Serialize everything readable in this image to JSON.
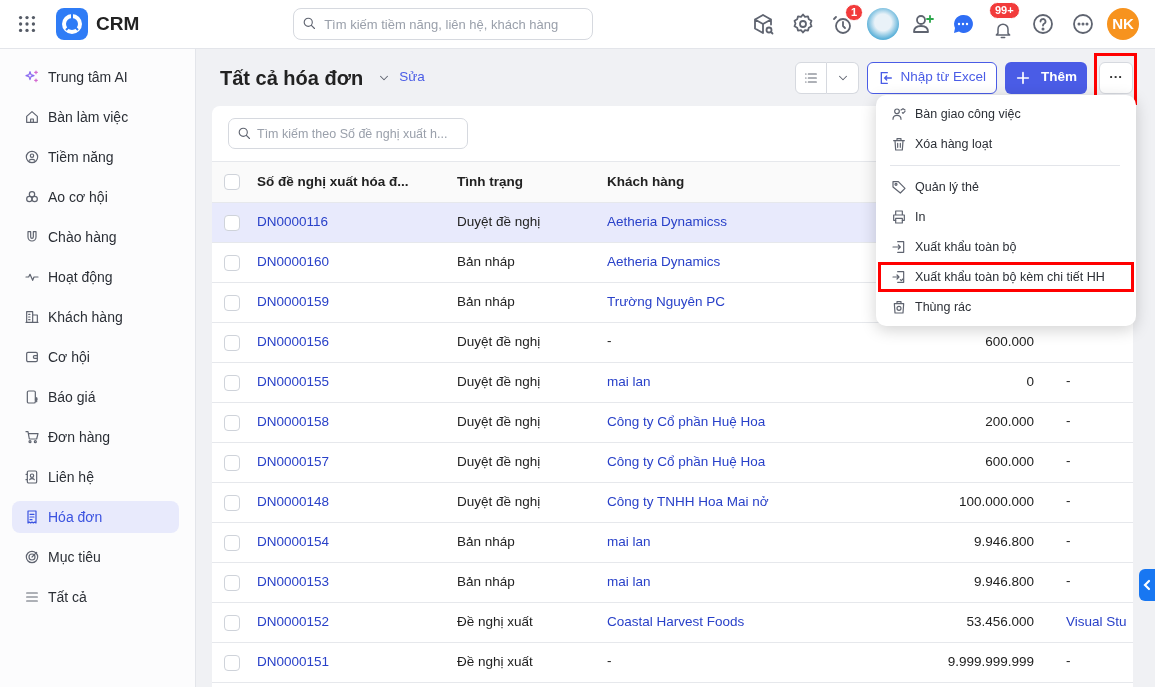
{
  "header": {
    "app_name": "CRM",
    "search": {
      "placeholder": "Tìm kiếm tiềm năng, liên hệ, khách hàng"
    },
    "timer_badge": "1",
    "notification_badge": "99+",
    "user_initials": "NK"
  },
  "sidebar": {
    "items": [
      {
        "label": "Trung tâm AI",
        "selected": false
      },
      {
        "label": "Bàn làm việc",
        "selected": false
      },
      {
        "label": "Tiềm năng",
        "selected": false
      },
      {
        "label": "Ao cơ hội",
        "selected": false
      },
      {
        "label": "Chào hàng",
        "selected": false
      },
      {
        "label": "Hoạt động",
        "selected": false
      },
      {
        "label": "Khách hàng",
        "selected": false
      },
      {
        "label": "Cơ hội",
        "selected": false
      },
      {
        "label": "Báo giá",
        "selected": false
      },
      {
        "label": "Đơn hàng",
        "selected": false
      },
      {
        "label": "Liên hệ",
        "selected": false
      },
      {
        "label": "Hóa đơn",
        "selected": true
      },
      {
        "label": "Mục tiêu",
        "selected": false
      },
      {
        "label": "Tất cả",
        "selected": false
      }
    ]
  },
  "page": {
    "title": "Tất cả hóa đơn",
    "edit_link": "Sửa",
    "import_button": "Nhập từ Excel",
    "add_button": "Thêm",
    "more_button": {
      "label": "···",
      "highlighted": true
    }
  },
  "menu": {
    "items": [
      {
        "label": "Bàn giao công việc",
        "highlighted": false
      },
      {
        "label": "Xóa hàng loạt",
        "highlighted": false
      },
      {
        "label": "Quản lý thẻ",
        "highlighted": false
      },
      {
        "label": "In",
        "highlighted": false
      },
      {
        "label": "Xuất khẩu toàn bộ",
        "highlighted": false
      },
      {
        "label": "Xuất khẩu toàn bộ kèm chi tiết HH",
        "highlighted": true
      },
      {
        "label": "Thùng rác",
        "highlighted": false
      }
    ]
  },
  "table": {
    "search": {
      "placeholder": "Tìm kiếm theo Số đề nghị xuất h..."
    },
    "select_all_checked": false,
    "columns": [
      "Số đề nghị xuất hóa đ...",
      "Tình trạng",
      "Khách hàng"
    ],
    "rows": [
      {
        "number": "DN0000116",
        "status": "Duyệt đề nghị",
        "customer": "Aetheria Dynamicss",
        "customer_link": true,
        "checked": false,
        "selected": true
      },
      {
        "number": "DN0000160",
        "status": "Bản nháp",
        "customer": "Aetheria Dynamics",
        "customer_link": true,
        "checked": false,
        "selected": false
      },
      {
        "number": "DN0000159",
        "status": "Bản nháp",
        "customer": "Trường Nguyên PC",
        "customer_link": true,
        "checked": false,
        "selected": false
      },
      {
        "number": "DN0000156",
        "status": "Duyệt đề nghị",
        "customer": "-",
        "customer_link": false,
        "amount": "600.000",
        "checked": false,
        "selected": false
      },
      {
        "number": "DN0000155",
        "status": "Duyệt đề nghị",
        "customer": "mai lan",
        "customer_link": true,
        "amount": "0",
        "column_5": "-",
        "checked": false,
        "selected": false
      },
      {
        "number": "DN0000158",
        "status": "Duyệt đề nghị",
        "customer": "Công ty Cổ phần Huệ Hoa",
        "customer_link": true,
        "amount": "200.000",
        "column_5": "-",
        "checked": false,
        "selected": false
      },
      {
        "number": "DN0000157",
        "status": "Duyệt đề nghị",
        "customer": "Công ty Cổ phần Huệ Hoa",
        "customer_link": true,
        "amount": "600.000",
        "column_5": "-",
        "checked": false,
        "selected": false
      },
      {
        "number": "DN0000148",
        "status": "Duyệt đề nghị",
        "customer": "Công ty TNHH Hoa Mai nở",
        "customer_link": true,
        "amount": "100.000.000",
        "column_5": "-",
        "checked": false,
        "selected": false
      },
      {
        "number": "DN0000154",
        "status": "Bản nháp",
        "customer": "mai lan",
        "customer_link": true,
        "amount": "9.946.800",
        "column_5": "-",
        "checked": false,
        "selected": false
      },
      {
        "number": "DN0000153",
        "status": "Bản nháp",
        "customer": "mai lan",
        "customer_link": true,
        "amount": "9.946.800",
        "column_5": "-",
        "checked": false,
        "selected": false
      },
      {
        "number": "DN0000152",
        "status": "Đề nghị xuất",
        "customer": "Coastal Harvest Foods",
        "customer_link": true,
        "amount": "53.456.000",
        "column_5": "Visual Stu",
        "checked": false,
        "selected": false
      },
      {
        "number": "DN0000151",
        "status": "Đề nghị xuất",
        "customer": "-",
        "customer_link": false,
        "amount": "9.999.999.999",
        "column_5": "-",
        "checked": false,
        "selected": false
      }
    ]
  }
}
